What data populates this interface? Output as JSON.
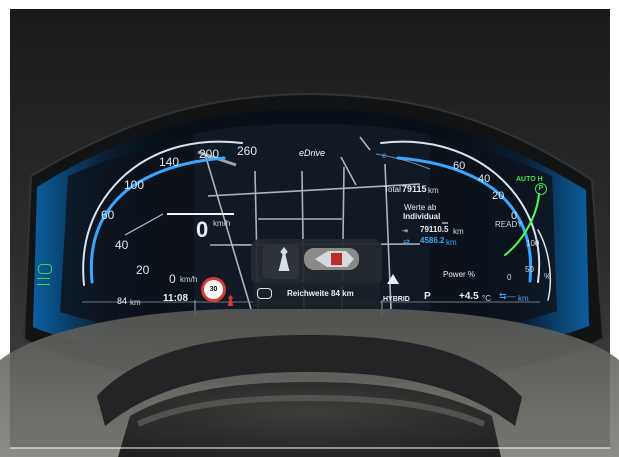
{
  "brand": "eDrive",
  "speedometer": {
    "ticks": [
      "20",
      "40",
      "60",
      "100",
      "140",
      "200",
      "260"
    ],
    "zero_tick": "0",
    "unit": "km/h",
    "current_speed": "0",
    "current_unit": "km/h"
  },
  "power_gauge": {
    "ticks": [
      "20",
      "40",
      "60"
    ],
    "zero_tick": "0",
    "ready": "READY",
    "charge_ticks": [
      "100",
      "50",
      "0"
    ],
    "charge_unit": "%",
    "charge_top_label": "e"
  },
  "auto_hold": "AUTO H",
  "trip": {
    "total_label": "Total",
    "total_value": "79115",
    "total_unit": "km",
    "values_from_label": "Werte ab",
    "values_from_value": "Individual",
    "distance_value": "79110.5",
    "distance_unit": "km",
    "electric_value": "4586.2",
    "electric_unit": "km"
  },
  "status_bar": {
    "range_left": "84",
    "range_left_unit": "km",
    "time": "11:08",
    "speed_limit": "30",
    "range_text": "Reichweite 84 km",
    "drive_mode": "HYBRID",
    "gear": "P",
    "temperature": "+4.5",
    "temperature_unit": "°C",
    "electric_range_unit": "km",
    "power_label": "Power %"
  },
  "colors": {
    "accent_blue": "#3aa6ff",
    "ready_green": "#43df4b",
    "warning_red": "#d83a34"
  },
  "icons": {
    "left_lights": "headlight-icon",
    "seatbelt": "seatbelt-warning-icon",
    "charging": "charging-cable-icon",
    "warning": "warning-triangle-icon",
    "auto_hold": "auto-hold-icon"
  }
}
